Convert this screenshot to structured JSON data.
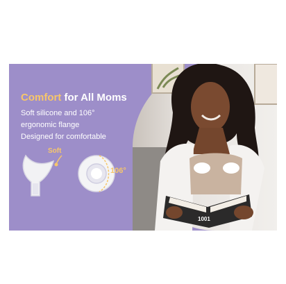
{
  "banner": {
    "headline_accent": "Comfort",
    "headline_rest": " for All Moms",
    "lines": [
      "Soft silicone and 106°",
      "ergonomic flange",
      "Designed for comfortable"
    ],
    "label_soft": "Soft",
    "label_degree": "106°",
    "book_text": "1001"
  },
  "colors": {
    "background": "#9d8ec9",
    "accent": "#f7c66a",
    "text": "#ffffff"
  },
  "icons": [
    "flange-side-view-icon",
    "flange-front-view-icon"
  ]
}
